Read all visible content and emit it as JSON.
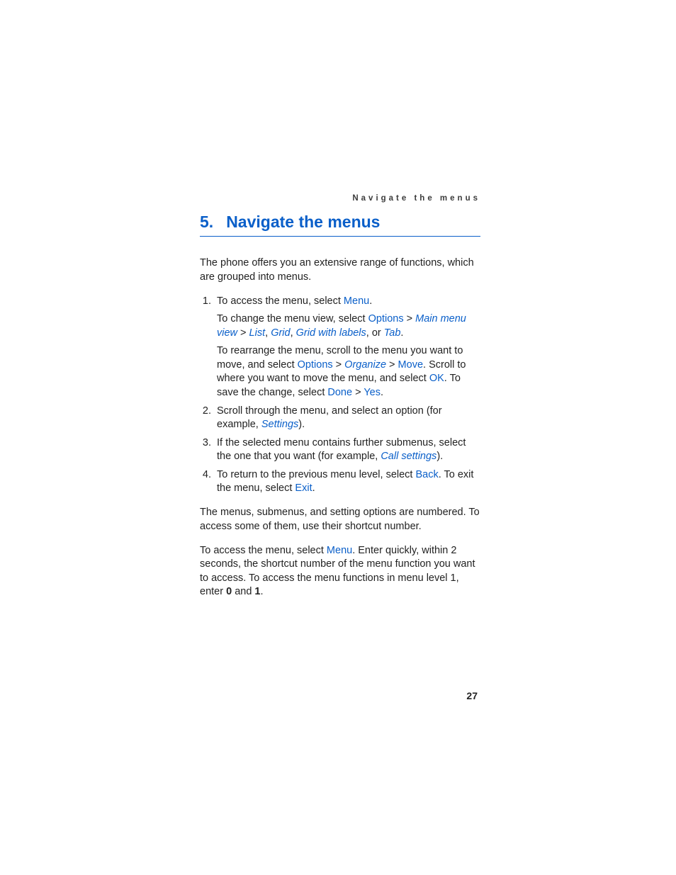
{
  "header": {
    "running": "Navigate the menus"
  },
  "heading": {
    "number": "5.",
    "title": "Navigate the menus"
  },
  "intro": "The phone offers you an extensive range of functions, which are grouped into menus.",
  "steps": {
    "s1": {
      "p1a": "To access the menu, select ",
      "menu": "Menu",
      "p1b": ".",
      "p2a": "To change the menu view, select ",
      "options": "Options",
      "gt1": " > ",
      "mainmenuview": "Main menu view",
      "gt2": " > ",
      "list": "List",
      "comma1": ", ",
      "grid": "Grid",
      "comma2": ", ",
      "gridlabels": "Grid with labels",
      "or": ", or ",
      "tab": "Tab",
      "period2": ".",
      "p3a": "To rearrange the menu, scroll to the menu you want to move, and select ",
      "options3": "Options",
      "gt3": " > ",
      "organize": "Organize",
      "gt4": " > ",
      "move": "Move",
      "p3b": ". Scroll to where you want to move the menu, and select ",
      "ok": "OK",
      "p3c": ". To save the change, select ",
      "done": "Done",
      "gt5": " > ",
      "yes": "Yes",
      "period3": "."
    },
    "s2": {
      "a": "Scroll through the menu, and select an option (for example, ",
      "settings": "Settings",
      "b": ")."
    },
    "s3": {
      "a": "If the selected menu contains further submenus, select the one that you want (for example, ",
      "callsettings": "Call settings",
      "b": ")."
    },
    "s4": {
      "a": "To return to the previous menu level, select ",
      "back": "Back",
      "b": ". To exit the menu, select ",
      "exit": "Exit",
      "c": "."
    }
  },
  "outro1": "The menus, submenus, and setting options are numbered. To access some of them, use their shortcut number.",
  "outro2": {
    "a": "To access the menu, select ",
    "menu": "Menu",
    "b": ". Enter quickly, within 2 seconds, the shortcut number of the menu function you want to access. To access the menu functions in menu level 1, enter ",
    "zero": "0",
    "and": " and ",
    "one": "1",
    "c": "."
  },
  "pagenum": "27"
}
